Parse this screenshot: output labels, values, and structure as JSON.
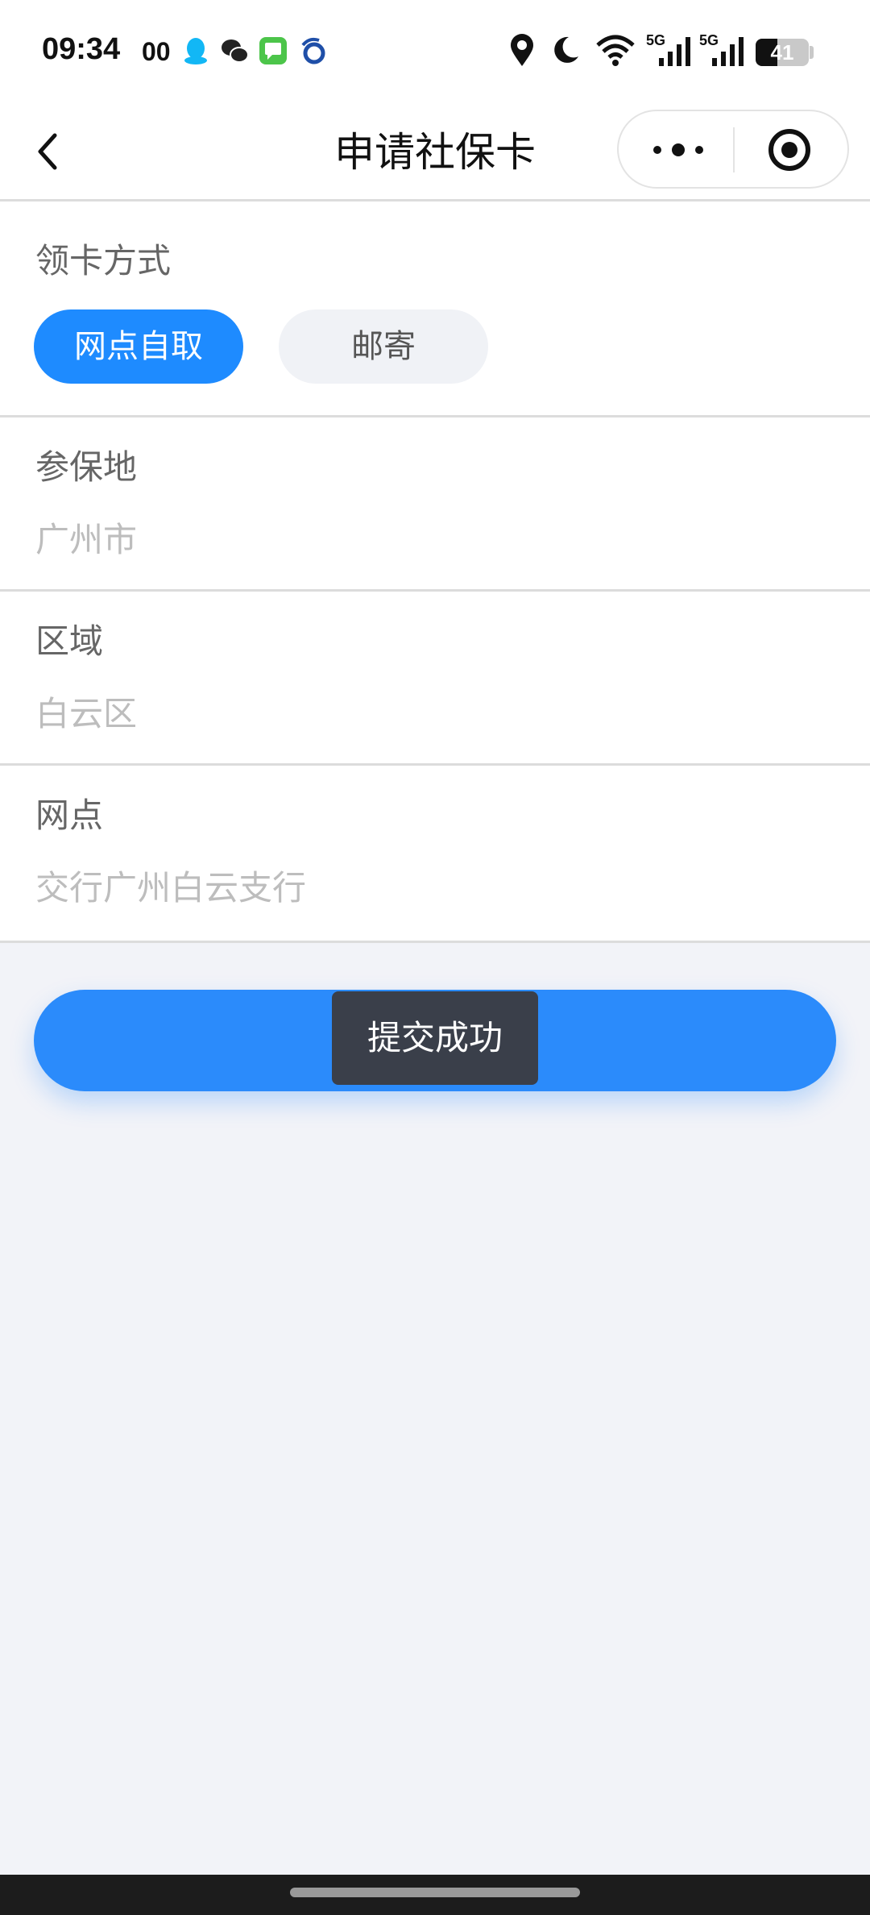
{
  "status_bar": {
    "time": "09:34",
    "carrier_text": "00",
    "battery": "41",
    "battery_level": 0.41,
    "network_1": "5G",
    "network_2": "5G",
    "app_icons": [
      "qq-icon",
      "wechat-icon",
      "messages-icon",
      "browser-icon"
    ],
    "system_icons": [
      "location-icon",
      "moon-icon",
      "wifi-icon",
      "signal-icon",
      "signal-icon",
      "battery-icon"
    ]
  },
  "nav": {
    "title": "申请社保卡"
  },
  "form": {
    "method_label": "领卡方式",
    "method_options": [
      "网点自取",
      "邮寄"
    ],
    "method_selected": "网点自取",
    "fields": [
      {
        "label": "参保地",
        "value": "广州市"
      },
      {
        "label": "区域",
        "value": "白云区"
      },
      {
        "label": "网点",
        "value": "交行广州白云支行"
      }
    ]
  },
  "toast": {
    "text": "提交成功"
  },
  "colors": {
    "primary": "#1e8bff",
    "button": "#2b8bfb",
    "background": "#f2f3f8",
    "toast_bg": "#3a3f4a",
    "placeholder": "#bdbdbd"
  }
}
